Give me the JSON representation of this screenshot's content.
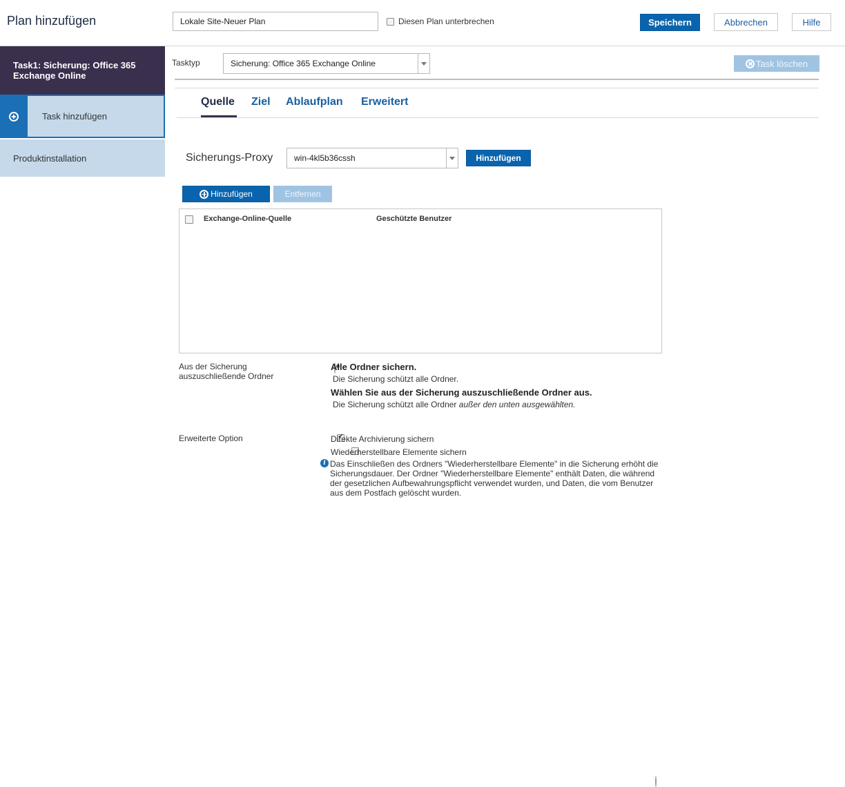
{
  "header": {
    "title": "Plan hinzufügen",
    "plan_name_value": "Lokale Site-Neuer Plan",
    "pause_label": "Diesen Plan unterbrechen",
    "save_label": "Speichern",
    "cancel_label": "Abbrechen",
    "help_label": "Hilfe"
  },
  "sidebar": {
    "task_label": "Task1: Sicherung: Office 365 Exchange Online",
    "add_task_label": "Task hinzufügen",
    "product_install_label": "Produktinstallation"
  },
  "main": {
    "tasktype_label": "Tasktyp",
    "tasktype_value": "Sicherung: Office 365 Exchange Online",
    "delete_task_label": "Task löschen",
    "tabs": [
      {
        "label": "Quelle"
      },
      {
        "label": "Ziel"
      },
      {
        "label": "Ablaufplan"
      },
      {
        "label": "Erweitert"
      }
    ],
    "proxy_label": "Sicherungs-Proxy",
    "proxy_value": "win-4kl5b36cssh",
    "proxy_add_label": "Hinzufügen",
    "add_label": "Hinzufügen",
    "remove_label": "Entfernen",
    "table": {
      "col1": "Exchange-Online-Quelle",
      "col2": "Geschützte Benutzer"
    },
    "exclude": {
      "label_line1": "Aus der Sicherung",
      "label_line2": "auszuschließende Ordner",
      "opt1_title": "Alle Ordner sichern.",
      "opt1_desc": "Die Sicherung schützt alle Ordner.",
      "opt2_title": "Wählen Sie aus der Sicherung auszuschließende Ordner aus.",
      "opt2_desc_prefix": "Die Sicherung schützt alle Ordner ",
      "opt2_desc_italic": "außer den unten ausgewählten."
    },
    "advanced": {
      "label": "Erweiterte Option",
      "opt1": "Direkte Archivierung sichern",
      "opt2": "Wiederherstellbare Elemente sichern",
      "info": "Das Einschließen des Ordners \"Wiederherstellbare Elemente\" in die Sicherung erhöht die Sicherungsdauer. Der Ordner \"Wiederherstellbare Elemente\" enthält Daten, die während der gesetzlichen Aufbewahrungspflicht verwendet wurden, und Daten, die vom Benutzer aus dem Postfach gelöscht wurden."
    }
  },
  "colors": {
    "primary": "#0a64ad",
    "sidebar_dark": "#3b2f4e",
    "sidebar_light": "#c5d9ea",
    "link": "#1a5f9f"
  }
}
